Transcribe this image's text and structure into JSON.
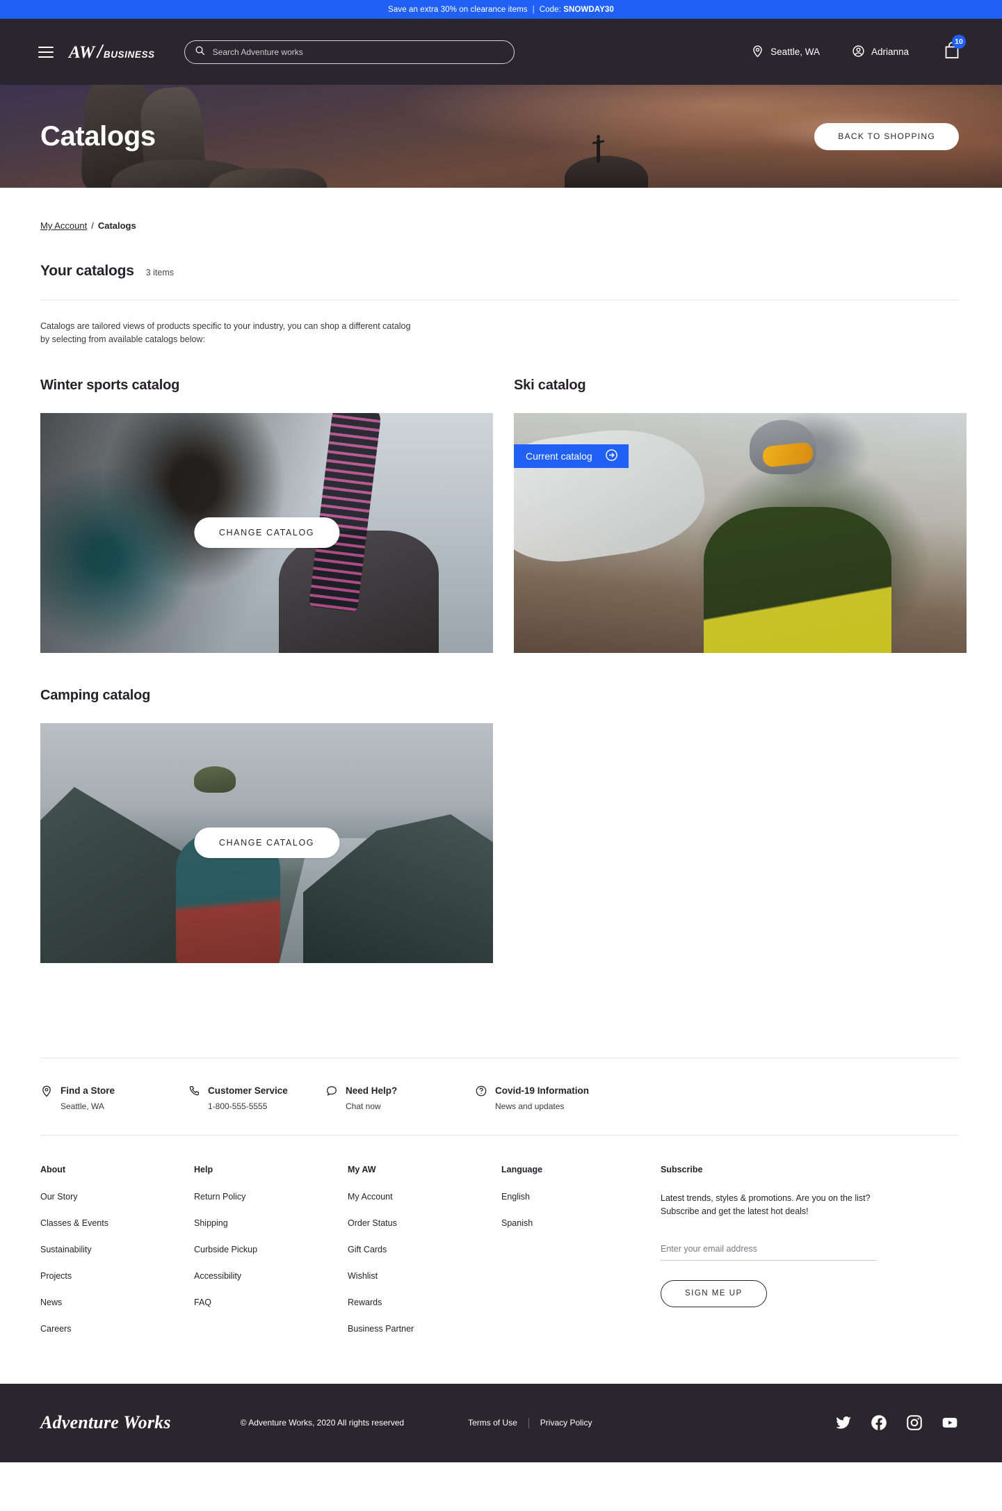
{
  "promo": {
    "text": "Save an extra 30% on clearance items",
    "separator": "|",
    "code_label": "Code:",
    "code": "SNOWDAY30"
  },
  "header": {
    "menu_icon": "hamburger-icon",
    "logo_aw": "AW",
    "logo_slash": "/",
    "logo_business": "BUSINESS",
    "search_placeholder": "Search Adventure works",
    "search_value": "",
    "location": "Seattle, WA",
    "account": "Adrianna",
    "cart_count": "10"
  },
  "hero": {
    "title": "Catalogs",
    "back_button": "BACK TO SHOPPING"
  },
  "breadcrumb": {
    "parent": "My Account",
    "separator": "/",
    "current": "Catalogs"
  },
  "section": {
    "title": "Your catalogs",
    "count": "3 items",
    "intro": "Catalogs are tailored views of products specific to your industry, you can shop a different catalog by selecting from available catalogs below:"
  },
  "catalogs": [
    {
      "title": "Winter sports catalog",
      "action": "CHANGE CATALOG",
      "is_current": false
    },
    {
      "title": "Ski catalog",
      "badge": "Current catalog",
      "is_current": true
    },
    {
      "title": "Camping catalog",
      "action": "CHANGE CATALOG",
      "is_current": false
    }
  ],
  "services": [
    {
      "icon": "location-pin-icon",
      "title": "Find a Store",
      "sub": "Seattle, WA"
    },
    {
      "icon": "phone-icon",
      "title": "Customer Service",
      "sub": "1-800-555-5555"
    },
    {
      "icon": "chat-bubble-icon",
      "title": "Need Help?",
      "sub": "Chat now"
    },
    {
      "icon": "question-circle-icon",
      "title": "Covid-19 Information",
      "sub": "News and updates"
    }
  ],
  "footer_columns": [
    {
      "heading": "About",
      "links": [
        "Our Story",
        "Classes & Events",
        "Sustainability",
        "Projects",
        "News",
        "Careers"
      ]
    },
    {
      "heading": "Help",
      "links": [
        "Return Policy",
        "Shipping",
        "Curbside Pickup",
        "Accessibility",
        "FAQ"
      ]
    },
    {
      "heading": "My AW",
      "links": [
        "My Account",
        "Order Status",
        "Gift Cards",
        "Wishlist",
        "Rewards",
        "Business Partner"
      ]
    },
    {
      "heading": "Language",
      "links": [
        "English",
        "Spanish"
      ]
    }
  ],
  "subscribe": {
    "heading": "Subscribe",
    "blurb_line1": "Latest trends, styles & promotions. Are you on the list?",
    "blurb_line2": "Subscribe and get the latest hot deals!",
    "email_placeholder": "Enter your email address",
    "email_value": "",
    "button": "SIGN ME UP"
  },
  "bottom": {
    "logo": "Adventure Works",
    "copyright": "© Adventure Works, 2020 All rights reserved",
    "terms": "Terms of Use",
    "privacy": "Privacy Policy",
    "socials": [
      "twitter-icon",
      "facebook-icon",
      "instagram-icon",
      "youtube-icon"
    ]
  },
  "colors": {
    "accent": "#2160f5",
    "dark": "#2b262d",
    "text": "#262229"
  }
}
